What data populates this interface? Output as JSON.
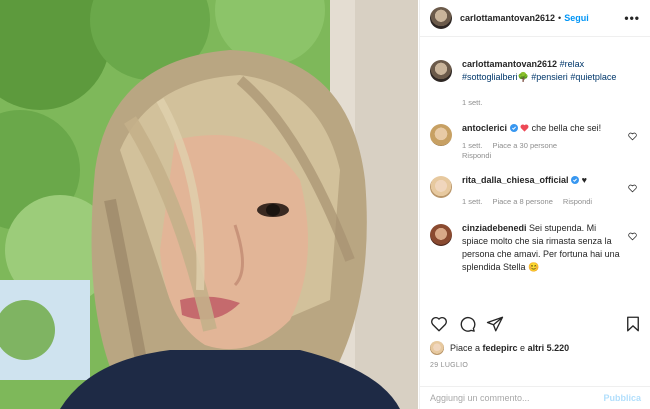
{
  "header": {
    "username": "carlottamantovan2612",
    "separator": "•",
    "follow_label": "Segui",
    "more_label": "•••"
  },
  "caption": {
    "username": "carlottamantovan2612",
    "tags": [
      "#relax",
      "#sottoglialberi",
      "🌳",
      "#pensieri",
      "#quietplace"
    ],
    "time": "1 sett."
  },
  "comments": [
    {
      "username": "antoclerici",
      "verified": true,
      "text": "che bella che sei!",
      "emoji": "❤️",
      "time": "1 sett.",
      "likes": "Piace a 30 persone",
      "reply": "Rispondi"
    },
    {
      "username": "rita_dalla_chiesa_official",
      "verified": true,
      "text": "♥",
      "time": "1 sett.",
      "likes": "Piace a 8 persone",
      "reply": "Rispondi"
    },
    {
      "username": "cinziadebenedi",
      "verified": false,
      "text": "Sei stupenda. Mi spiace molto che sia rimasta senza la persona che amavi. Per fortuna hai una splendida Stella",
      "emoji": "😊"
    }
  ],
  "likes": {
    "prefix": "Piace a ",
    "user": "fedepirc",
    "middle": " e ",
    "others": "altri 5.220"
  },
  "date": "29 LUGLIO",
  "add_comment": {
    "placeholder": "Aggiungi un commento...",
    "publish_label": "Pubblica"
  },
  "icons": {
    "like": "heart-icon",
    "comment": "comment-icon",
    "share": "share-icon",
    "save": "bookmark-icon",
    "verified": "verified-badge-icon"
  },
  "colors": {
    "link_blue": "#0095f6",
    "tag_blue": "#00376b",
    "verified_blue": "#3897f0",
    "heart_red": "#ed4956",
    "muted": "#8e8e8e",
    "publish_disabled": "#b2dffc"
  }
}
